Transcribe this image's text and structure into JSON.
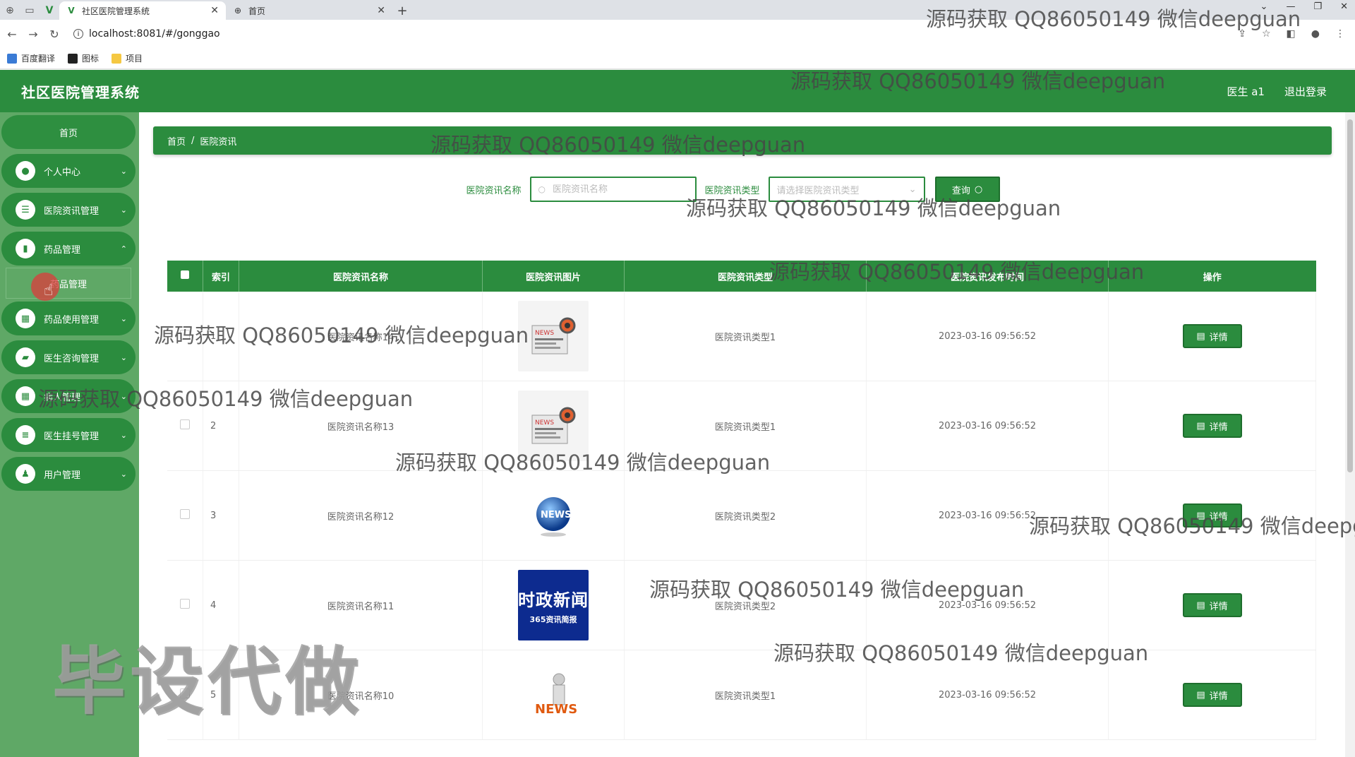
{
  "browser": {
    "tabs": [
      {
        "title": "社区医院管理系统",
        "active": true
      },
      {
        "title": "首页",
        "active": false
      }
    ],
    "url": "localhost:8081/#/gonggao",
    "bookmarks": [
      "百度翻译",
      "图标",
      "项目"
    ]
  },
  "header": {
    "title": "社区医院管理系统",
    "user": "医生 a1",
    "logout": "退出登录"
  },
  "sidebar": {
    "home": "首页",
    "items": [
      {
        "label": "个人中心",
        "icon": "user-icon"
      },
      {
        "label": "医院资讯管理",
        "icon": "sliders-icon"
      },
      {
        "label": "药品管理",
        "icon": "bar-chart-icon"
      },
      {
        "label": "药品使用管理",
        "icon": "grid-icon"
      },
      {
        "label": "医生咨询管理",
        "icon": "wallet-icon"
      },
      {
        "label": "病人管理",
        "icon": "apps-icon"
      },
      {
        "label": "医生挂号管理",
        "icon": "list-icon"
      },
      {
        "label": "用户管理",
        "icon": "person-icon"
      }
    ],
    "active_sub": "药品管理"
  },
  "breadcrumb": {
    "home": "首页",
    "sep": "/",
    "current": "医院资讯"
  },
  "search": {
    "name_label": "医院资讯名称",
    "name_placeholder": "医院资讯名称",
    "type_label": "医院资讯类型",
    "type_placeholder": "请选择医院资讯类型",
    "query_label": "查询"
  },
  "table": {
    "columns": [
      "索引",
      "医院资讯名称",
      "医院资讯图片",
      "医院资讯类型",
      "医院资讯发布时间",
      "操作"
    ],
    "detail_label": "详情",
    "rows": [
      {
        "index": "1",
        "name": "医院资讯名称14",
        "image": "news-paper",
        "type": "医院资讯类型1",
        "time": "2023-03-16 09:56:52"
      },
      {
        "index": "2",
        "name": "医院资讯名称13",
        "image": "news-paper",
        "type": "医院资讯类型1",
        "time": "2023-03-16 09:56:52"
      },
      {
        "index": "3",
        "name": "医院资讯名称12",
        "image": "news-globe",
        "type": "医院资讯类型2",
        "time": "2023-03-16 09:56:52"
      },
      {
        "index": "4",
        "name": "医院资讯名称11",
        "image": "news-banner",
        "type": "医院资讯类型2",
        "time": "2023-03-16 09:56:52"
      },
      {
        "index": "5",
        "name": "医院资讯名称10",
        "image": "news-figure",
        "type": "医院资讯类型1",
        "time": "2023-03-16 09:56:52"
      }
    ],
    "banner_text_big": "时政新闻",
    "banner_text_small": "365资讯简报"
  },
  "watermarks": {
    "text": "源码获取 QQ86050149 微信deepguan",
    "big": "毕设代做"
  },
  "colors": {
    "primary": "#2b8c3e",
    "sidebar_bg": "#5fa866"
  }
}
